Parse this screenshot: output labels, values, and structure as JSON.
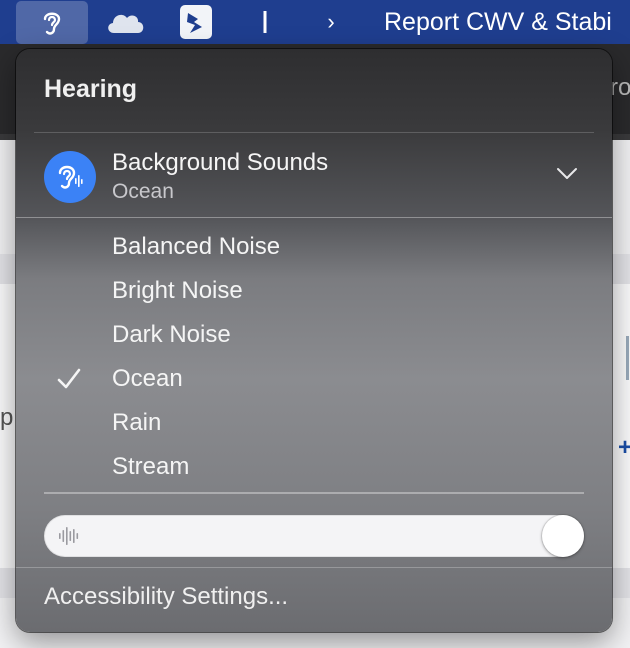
{
  "menubar": {
    "title": "Report CWV & Stabi",
    "icons": [
      "hearing-icon",
      "cloud-icon",
      "bird-app-icon",
      "text-cursor-icon",
      "chevron-right-icon"
    ],
    "chevron_glyph": "›",
    "accent": "#1f3e8f"
  },
  "background": {
    "partial_text_right": "ro",
    "partial_text_left": "p",
    "plus_glyph": "+"
  },
  "panel": {
    "title": "Hearing",
    "background_sounds": {
      "label": "Background Sounds",
      "current": "Ocean",
      "icon": "hearing-waves-icon",
      "icon_color": "#3b82f6",
      "expanded": true
    },
    "sounds": [
      {
        "label": "Balanced Noise",
        "selected": false
      },
      {
        "label": "Bright Noise",
        "selected": false
      },
      {
        "label": "Dark Noise",
        "selected": false
      },
      {
        "label": "Ocean",
        "selected": true
      },
      {
        "label": "Rain",
        "selected": false
      },
      {
        "label": "Stream",
        "selected": false
      }
    ],
    "volume": {
      "icon": "waveform-icon",
      "level": 1.0
    },
    "footer": "Accessibility Settings..."
  }
}
